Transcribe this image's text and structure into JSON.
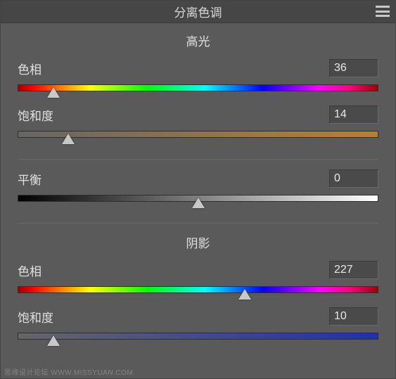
{
  "header": {
    "title": "分离色调"
  },
  "highlights": {
    "section_label": "高光",
    "hue_label": "色相",
    "hue_value": "36",
    "hue_pct": 10,
    "sat_label": "饱和度",
    "sat_value": "14",
    "sat_pct": 14
  },
  "balance": {
    "label": "平衡",
    "value": "0",
    "pct": 50
  },
  "shadows": {
    "section_label": "阴影",
    "hue_label": "色相",
    "hue_value": "227",
    "hue_pct": 63,
    "sat_label": "饱和度",
    "sat_value": "10",
    "sat_pct": 10
  },
  "watermark": "思缘设计论坛  WWW.MISSYUAN.COM"
}
